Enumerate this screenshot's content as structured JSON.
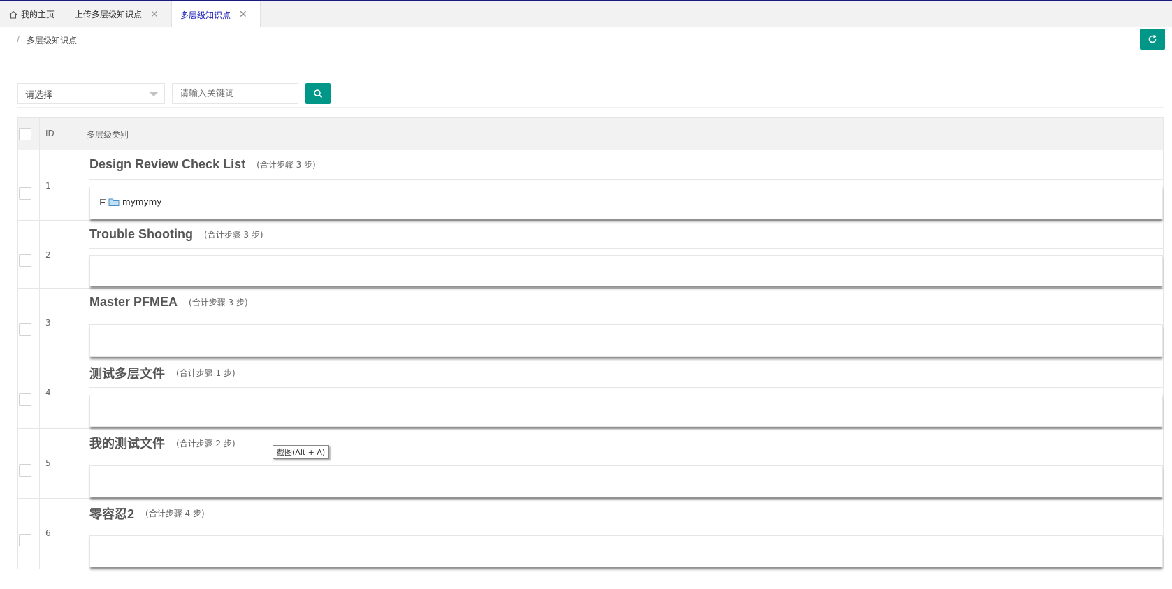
{
  "tabs": {
    "home": {
      "label": "我的主页",
      "icon": "home-icon"
    },
    "upload": {
      "label": "上传多层级知识点",
      "close": "✕"
    },
    "active": {
      "label": "多层级知识点",
      "close": "✕"
    }
  },
  "breadcrumb": {
    "separator": "/",
    "current": "多层级知识点"
  },
  "toolbar": {
    "refresh_icon": "refresh-icon",
    "accent_color": "#009688"
  },
  "search": {
    "select_placeholder": "请选择",
    "keyword_placeholder": "请输入关键词",
    "search_icon": "search-icon"
  },
  "table": {
    "headers": {
      "id": "ID",
      "category": "多层级类别"
    },
    "rows": [
      {
        "id": "1",
        "title": "Design Review Check List",
        "steps": "(合计步骤 3 步)",
        "tree": "mymymy"
      },
      {
        "id": "2",
        "title": "Trouble Shooting",
        "steps": "(合计步骤 3 步)"
      },
      {
        "id": "3",
        "title": "Master PFMEA",
        "steps": "(合计步骤 3 步)"
      },
      {
        "id": "4",
        "title": "测试多层文件",
        "steps": "(合计步骤 1 步)"
      },
      {
        "id": "5",
        "title": "我的测试文件",
        "steps": "(合计步骤 2 步)"
      },
      {
        "id": "6",
        "title": "零容忍2",
        "steps": "(合计步骤 4 步)"
      }
    ]
  },
  "tooltip": {
    "text": "截图(Alt + A)"
  }
}
